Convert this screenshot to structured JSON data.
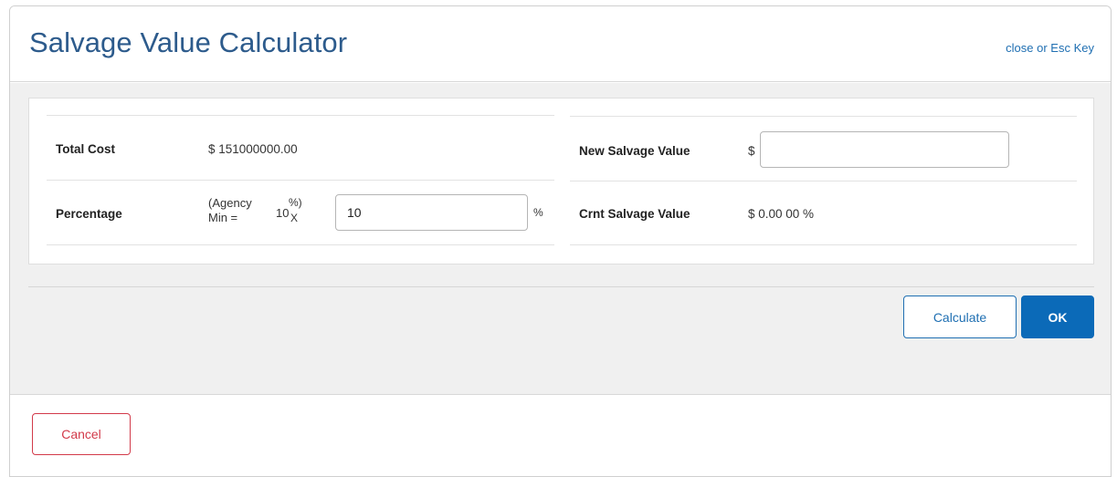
{
  "header": {
    "title": "Salvage Value Calculator",
    "close_label": "close or Esc Key"
  },
  "form": {
    "total_cost": {
      "label": "Total Cost",
      "value": "$ 151000000.00"
    },
    "percentage": {
      "label": "Percentage",
      "note_line1": "(Agency",
      "note_line2": "Min =",
      "min_value": "10",
      "sup_text": "%)",
      "sub_text": "X",
      "input_value": "10",
      "unit": "%"
    },
    "new_salvage": {
      "label": "New Salvage Value",
      "prefix": "$",
      "input_value": ""
    },
    "crnt_salvage": {
      "label": "Crnt Salvage Value",
      "value": "$ 0.00 00 %"
    }
  },
  "actions": {
    "calculate_label": "Calculate",
    "ok_label": "OK",
    "cancel_label": "Cancel"
  },
  "colors": {
    "title": "#2d5b8c",
    "link": "#1f6fb2",
    "primary": "#0b6ab8",
    "danger": "#d23a4a"
  }
}
